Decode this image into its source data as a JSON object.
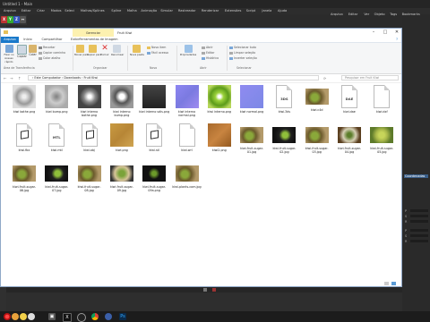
{
  "app_bg": {
    "title": "Untitled 1 - Main",
    "menu": [
      "Arquivo",
      "Editar",
      "Criar",
      "Modos",
      "Seleci",
      "Malhas/Splines",
      "Spline",
      "Malha",
      "Animação",
      "Simular",
      "Rastreador",
      "Renderizar",
      "Extensões",
      "Script",
      "Janela",
      "Ajuda"
    ],
    "right_menu": [
      "Arquivo",
      "Editar",
      "Ver",
      "Objeto",
      "Tags",
      "Bookmarks"
    ],
    "right_labels": [
      "Coordenadas",
      "P",
      "S",
      "R",
      "P",
      "S",
      "R"
    ]
  },
  "explorer": {
    "title": "Fruit Kiwi",
    "context_tab": "Gerenciar",
    "ribbon_tabs": [
      "Arquivo",
      "Início",
      "Compartilhar",
      "Exibir",
      "Ferramentas de Imagem"
    ],
    "ribbon": {
      "pin_label": "Fixar no Acesso rápido",
      "copy_label": "Copiar",
      "paste_label": "Colar",
      "cut_label": "Recortar",
      "copy_path_label": "Copiar caminho",
      "paste_shortcut_label": "Colar atalho",
      "clipboard_group": "Área de Transferência",
      "move_label": "Mover para",
      "copy_to_label": "Copiar para",
      "delete_label": "Excluir",
      "rename_label": "Renomear",
      "organize_group": "Organizar",
      "new_folder_label": "Nova pasta",
      "new_item_label": "Novo item",
      "easy_access_label": "Fácil acesso",
      "new_group": "Novo",
      "properties_label": "Propriedades",
      "open_label": "Abrir",
      "edit_label": "Editar",
      "history_label": "Histórico",
      "open_group": "Abrir",
      "select_all_label": "Selecionar tudo",
      "select_none_label": "Limpar seleção",
      "invert_label": "Inverter seleção",
      "select_group": "Selecionar"
    },
    "breadcrumb": "› Este Computador › Downloads › Fruit Kiwi",
    "search_placeholder": "Pesquisar em Fruit Kiwi",
    "files": [
      {
        "name": "kiwi bothe.png",
        "kind": "bump",
        "col": 0,
        "row": 0
      },
      {
        "name": "kiwi bump.png",
        "kind": "bump2",
        "col": 1,
        "row": 0
      },
      {
        "name": "kiwi interno bothe.png",
        "kind": "bump3",
        "col": 2,
        "row": 0
      },
      {
        "name": "kiwi interno bump.png",
        "kind": "bump4",
        "col": 3,
        "row": 0
      },
      {
        "name": "kiwi interno sdis.png",
        "kind": "dark",
        "col": 4,
        "row": 0
      },
      {
        "name": "kiwi interno normal.png",
        "kind": "normal",
        "col": 5,
        "row": 0
      },
      {
        "name": "kiwi interno.png",
        "kind": "green",
        "col": 6,
        "row": 0
      },
      {
        "name": "kiwi normal.png",
        "kind": "normal2",
        "col": 7,
        "row": 0
      },
      {
        "name": "kiwi.3ds",
        "kind": "doc",
        "tag": "3DS",
        "col": 8,
        "row": 0
      },
      {
        "name": "kiwi.c4d",
        "kind": "photo",
        "col": 9,
        "row": 0
      },
      {
        "name": "kiwi.dae",
        "kind": "doc",
        "tag": "DAE",
        "col": 10,
        "row": 0
      },
      {
        "name": "kiwi.dxf",
        "kind": "blank",
        "col": 11,
        "row": 0
      },
      {
        "name": "kiwi.fbx",
        "kind": "cube",
        "col": 0,
        "row": 1
      },
      {
        "name": "kiwi.mtl",
        "kind": "doc",
        "tag": "MTL",
        "col": 1,
        "row": 1
      },
      {
        "name": "kiwi.obj",
        "kind": "cube",
        "col": 2,
        "row": 1
      },
      {
        "name": "kiwi.png",
        "kind": "tan",
        "col": 3,
        "row": 1
      },
      {
        "name": "kiwi.stl",
        "kind": "cube",
        "col": 4,
        "row": 1
      },
      {
        "name": "kiwi.wrl",
        "kind": "blank",
        "col": 5,
        "row": 1
      },
      {
        "name": "kiwi2.png",
        "kind": "brown",
        "col": 6,
        "row": 1
      },
      {
        "name": "kiwi-fruit-sugar-01.jpg",
        "kind": "photo",
        "col": 7,
        "row": 1
      },
      {
        "name": "kiwi-fruit-sugar-02.jpg",
        "kind": "photo2",
        "col": 8,
        "row": 1
      },
      {
        "name": "kiwi-fruit-sugar-03.jpg",
        "kind": "photo",
        "col": 9,
        "row": 1
      },
      {
        "name": "kiwi-fruit-sugar-04.jpg",
        "kind": "photo3",
        "col": 10,
        "row": 1
      },
      {
        "name": "kiwi-fruit-sugar-05.jpg",
        "kind": "photo4",
        "col": 11,
        "row": 1
      },
      {
        "name": "kiwi-fruit-sugar-06.jpg",
        "kind": "photo",
        "col": 0,
        "row": 2
      },
      {
        "name": "kiwi-fruit-sugar-07.jpg",
        "kind": "photo2",
        "col": 1,
        "row": 2
      },
      {
        "name": "kiwi-fruit-sugar-08.jpg",
        "kind": "photo",
        "col": 2,
        "row": 2
      },
      {
        "name": "kiwi-fruit-sugar-09.jpg",
        "kind": "photo5",
        "col": 3,
        "row": 2
      },
      {
        "name": "kiwi-fruit-sugar-09a.png",
        "kind": "dark2",
        "col": 4,
        "row": 2
      },
      {
        "name": "kiwi-plants-com.jpg",
        "kind": "photo",
        "col": 5,
        "row": 2
      }
    ],
    "colors": {
      "accent": "#1979ca",
      "context_tab": "#fdf1b0",
      "border": "#8fa8c7"
    }
  },
  "taskbar": {
    "icons": [
      "start-icon",
      "chrome-icon",
      "x-icon",
      "cinema4d-icon",
      "photoshop-icon",
      "explorer-icon"
    ]
  }
}
